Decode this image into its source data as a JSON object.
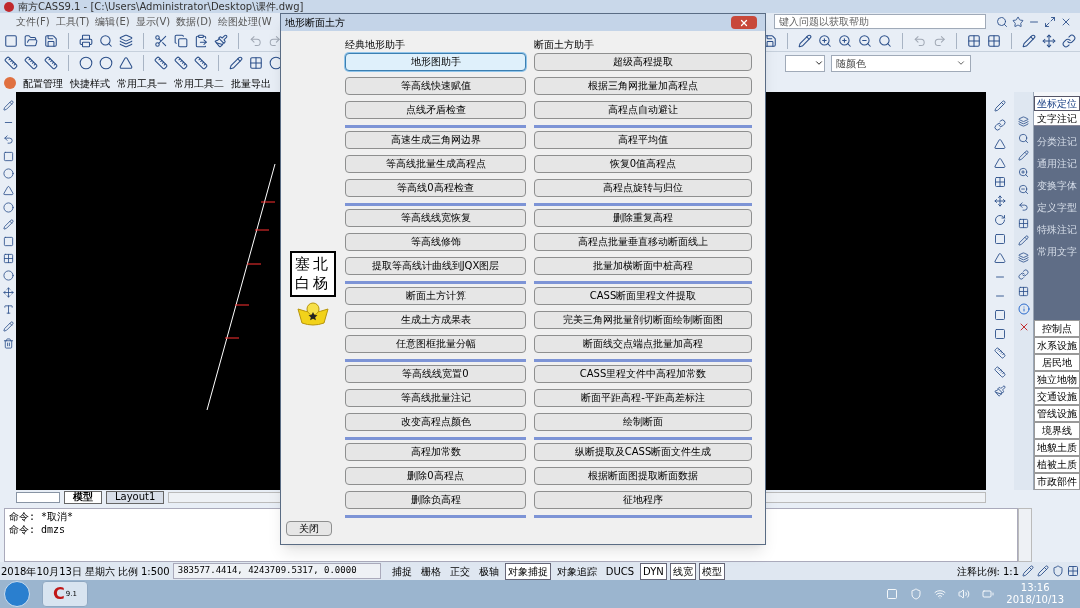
{
  "window": {
    "title": "南方CASS9.1 - [C:\\Users\\Administrator\\Desktop\\课件.dwg]"
  },
  "menu": [
    "文件(F)",
    "工具(T)",
    "编辑(E)",
    "显示(V)",
    "数据(D)",
    "绘图处理(W"
  ],
  "help_field": {
    "placeholder": "键入问题以获取帮助"
  },
  "custom_toolbar": [
    "配置管理",
    "快捷样式",
    "常用工具一",
    "常用工具二",
    "批量导出"
  ],
  "color_dropdown": {
    "value": "随颜色"
  },
  "layout_tabs": [
    {
      "label": "模型",
      "selected": true
    },
    {
      "label": "Layout1",
      "selected": false
    }
  ],
  "command_lines": [
    "命令: *取消*",
    "命令: dmzs"
  ],
  "status_bar": {
    "date": "2018年10月13日",
    "weekday": "星期六",
    "scale_label": "比例",
    "scale": "1:500",
    "coords": "383577.4414, 4243709.5317, 0.0000",
    "toggles": [
      {
        "label": "捕捉",
        "on": false
      },
      {
        "label": "栅格",
        "on": false
      },
      {
        "label": "正交",
        "on": false
      },
      {
        "label": "极轴",
        "on": false
      },
      {
        "label": "对象捕捉",
        "on": true
      },
      {
        "label": "对象追踪",
        "on": false
      },
      {
        "label": "DUCS",
        "on": false
      },
      {
        "label": "DYN",
        "on": true
      },
      {
        "label": "线宽",
        "on": true
      },
      {
        "label": "模型",
        "on": true
      }
    ],
    "annotation_label": "注释比例:",
    "annotation_scale": "1:1"
  },
  "right_panel": {
    "tabs": [
      {
        "label": "坐标定位",
        "selected": true
      }
    ],
    "section": {
      "label": "文字注记",
      "expanded": true
    },
    "sub_items": [
      "分类注记",
      "通用注记",
      "变换字体",
      "定义字型",
      "特殊注记",
      "常用文字"
    ],
    "categories": [
      "控制点",
      "水系设施",
      "居民地",
      "独立地物",
      "交通设施",
      "管线设施",
      "境界线",
      "地貌土质",
      "植被土质",
      "市政部件"
    ]
  },
  "dialog": {
    "title": "地形断面土方",
    "logo_lines": [
      "塞北",
      "白杨"
    ],
    "groups": [
      {
        "title": "经典地形助手",
        "sections": [
          [
            {
              "label": "地形图助手",
              "focused": true
            },
            {
              "label": "等高线快速赋值",
              "focused": false
            },
            {
              "label": "点线矛盾检查",
              "focused": false
            }
          ],
          [
            {
              "label": "高速生成三角网边界",
              "focused": false
            },
            {
              "label": "等高线批量生成高程点",
              "focused": false
            },
            {
              "label": "等高线0高程检查",
              "focused": false
            }
          ],
          [
            {
              "label": "等高线线宽恢复",
              "focused": false
            },
            {
              "label": "等高线修饰",
              "focused": false
            },
            {
              "label": "提取等高线计曲线到JQX图层",
              "focused": false
            }
          ],
          [
            {
              "label": "断面土方计算",
              "focused": false
            },
            {
              "label": "生成土方成果表",
              "focused": false
            },
            {
              "label": "任意图框批量分幅",
              "focused": false
            }
          ],
          [
            {
              "label": "等高线线宽置0",
              "focused": false
            },
            {
              "label": "等高线批量注记",
              "focused": false
            },
            {
              "label": "改变高程点颜色",
              "focused": false
            }
          ],
          [
            {
              "label": "高程加常数",
              "focused": false
            },
            {
              "label": "删除0高程点",
              "focused": false
            },
            {
              "label": "删除负高程",
              "focused": false
            }
          ]
        ]
      },
      {
        "title": "断面土方助手",
        "sections": [
          [
            {
              "label": "超级高程提取",
              "focused": false
            },
            {
              "label": "根据三角网批量加高程点",
              "focused": false
            },
            {
              "label": "高程点自动避让",
              "focused": false
            }
          ],
          [
            {
              "label": "高程平均值",
              "focused": false
            },
            {
              "label": "恢复0值高程点",
              "focused": false
            },
            {
              "label": "高程点旋转与归位",
              "focused": false
            }
          ],
          [
            {
              "label": "删除重复高程",
              "focused": false
            },
            {
              "label": "高程点批量垂直移动断面线上",
              "focused": false
            },
            {
              "label": "批量加横断面中桩高程",
              "focused": false
            }
          ],
          [
            {
              "label": "CASS断面里程文件提取",
              "focused": false
            },
            {
              "label": "完美三角网批量剖切断面绘制断面图",
              "focused": false
            },
            {
              "label": "断面线交点端点批量加高程",
              "focused": false
            }
          ],
          [
            {
              "label": "CASS里程文件中高程加常数",
              "focused": false
            },
            {
              "label": "断面平距高程-平距高差标注",
              "focused": false
            },
            {
              "label": "绘制断面",
              "focused": false
            }
          ],
          [
            {
              "label": "纵断提取及CASS断面文件生成",
              "focused": false
            },
            {
              "label": "根据断面图提取断面数据",
              "focused": false
            },
            {
              "label": "征地程序",
              "focused": false
            }
          ]
        ]
      }
    ],
    "close_button": "关闭"
  },
  "taskbar": {
    "app_letter": "C",
    "app_version": "9.1",
    "time": "13:16",
    "date": "2018/10/13"
  }
}
